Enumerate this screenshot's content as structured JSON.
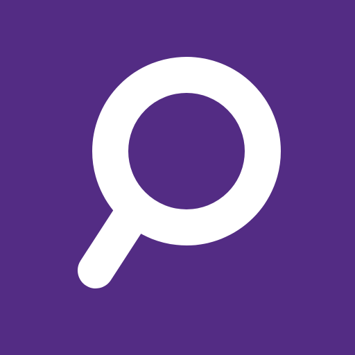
{
  "icon": {
    "name": "search-icon",
    "background_color": "#532C84",
    "glyph_color": "#FFFFFF"
  }
}
